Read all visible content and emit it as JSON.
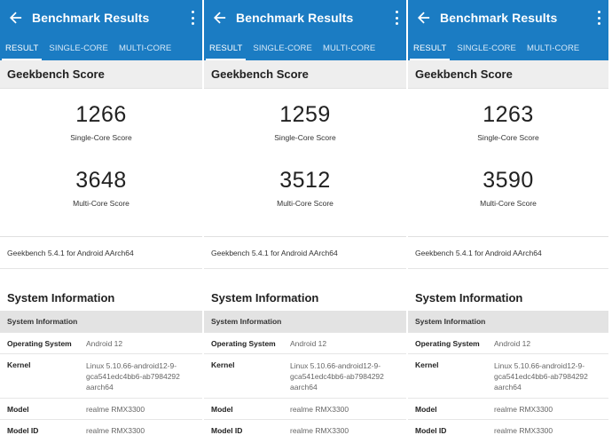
{
  "panels": [
    {
      "header": {
        "title": "Benchmark Results",
        "back_icon": "arrow-left-icon",
        "more_icon": "more-vertical-icon"
      },
      "tabs": [
        {
          "label": "RESULT",
          "active": true
        },
        {
          "label": "SINGLE-CORE",
          "active": false
        },
        {
          "label": "MULTI-CORE",
          "active": false
        }
      ],
      "score_section_title": "Geekbench Score",
      "single_core": {
        "value": "1266",
        "label": "Single-Core Score"
      },
      "multi_core": {
        "value": "3648",
        "label": "Multi-Core Score"
      },
      "version": "Geekbench 5.4.1 for Android AArch64",
      "system_title": "System Information",
      "system_subheader": "System Information",
      "rows": [
        {
          "label": "Operating System",
          "value": "Android 12"
        },
        {
          "label": "Kernel",
          "value": "Linux 5.10.66-android12-9-gca541edc4bb6-ab7984292 aarch64"
        },
        {
          "label": "Model",
          "value": "realme RMX3300"
        },
        {
          "label": "Model ID",
          "value": "realme RMX3300"
        }
      ]
    },
    {
      "header": {
        "title": "Benchmark Results",
        "back_icon": "arrow-left-icon",
        "more_icon": "more-vertical-icon"
      },
      "tabs": [
        {
          "label": "RESULT",
          "active": true
        },
        {
          "label": "SINGLE-CORE",
          "active": false
        },
        {
          "label": "MULTI-CORE",
          "active": false
        }
      ],
      "score_section_title": "Geekbench Score",
      "single_core": {
        "value": "1259",
        "label": "Single-Core Score"
      },
      "multi_core": {
        "value": "3512",
        "label": "Multi-Core Score"
      },
      "version": "Geekbench 5.4.1 for Android AArch64",
      "system_title": "System Information",
      "system_subheader": "System Information",
      "rows": [
        {
          "label": "Operating System",
          "value": "Android 12"
        },
        {
          "label": "Kernel",
          "value": "Linux 5.10.66-android12-9-gca541edc4bb6-ab7984292 aarch64"
        },
        {
          "label": "Model",
          "value": "realme RMX3300"
        },
        {
          "label": "Model ID",
          "value": "realme RMX3300"
        }
      ]
    },
    {
      "header": {
        "title": "Benchmark Results",
        "back_icon": "arrow-left-icon",
        "more_icon": "more-vertical-icon"
      },
      "tabs": [
        {
          "label": "RESULT",
          "active": true
        },
        {
          "label": "SINGLE-CORE",
          "active": false
        },
        {
          "label": "MULTI-CORE",
          "active": false
        }
      ],
      "score_section_title": "Geekbench Score",
      "single_core": {
        "value": "1263",
        "label": "Single-Core Score"
      },
      "multi_core": {
        "value": "3590",
        "label": "Multi-Core Score"
      },
      "version": "Geekbench 5.4.1 for Android AArch64",
      "system_title": "System Information",
      "system_subheader": "System Information",
      "rows": [
        {
          "label": "Operating System",
          "value": "Android 12"
        },
        {
          "label": "Kernel",
          "value": "Linux 5.10.66-android12-9-gca541edc4bb6-ab7984292 aarch64"
        },
        {
          "label": "Model",
          "value": "realme RMX3300"
        },
        {
          "label": "Model ID",
          "value": "realme RMX3300"
        }
      ]
    }
  ],
  "colors": {
    "app_bar": "#1b7cc3",
    "section_header_bg": "#eeeeee",
    "subheader_bg": "#e3e3e3"
  }
}
